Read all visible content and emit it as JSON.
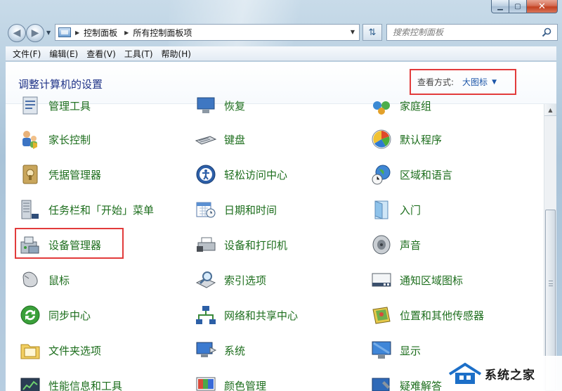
{
  "window": {
    "min_glyph": "▁",
    "max_glyph": "▢",
    "close_glyph": "✕"
  },
  "address": {
    "crumbs": [
      "控制面板",
      "所有控制面板项"
    ]
  },
  "search": {
    "placeholder": "搜索控制面板"
  },
  "menu": [
    "文件(F)",
    "编辑(E)",
    "查看(V)",
    "工具(T)",
    "帮助(H)"
  ],
  "header": {
    "title": "调整计算机的设置",
    "view_label": "查看方式:",
    "view_value": "大图标"
  },
  "items": {
    "col1": [
      "管理工具",
      "家长控制",
      "凭据管理器",
      "任务栏和「开始」菜单",
      "设备管理器",
      "鼠标",
      "同步中心",
      "文件夹选项",
      "性能信息和工具"
    ],
    "col2": [
      "恢复",
      "键盘",
      "轻松访问中心",
      "日期和时间",
      "设备和打印机",
      "索引选项",
      "网络和共享中心",
      "系统",
      "颜色管理"
    ],
    "col3": [
      "家庭组",
      "默认程序",
      "区域和语言",
      "入门",
      "声音",
      "通知区域图标",
      "位置和其他传感器",
      "显示",
      "疑难解答"
    ]
  },
  "watermark": {
    "text": "系统之家"
  },
  "colors": {
    "link_green": "#1d6e1d",
    "title_blue": "#1e3287",
    "highlight_red": "#e23b3b"
  }
}
